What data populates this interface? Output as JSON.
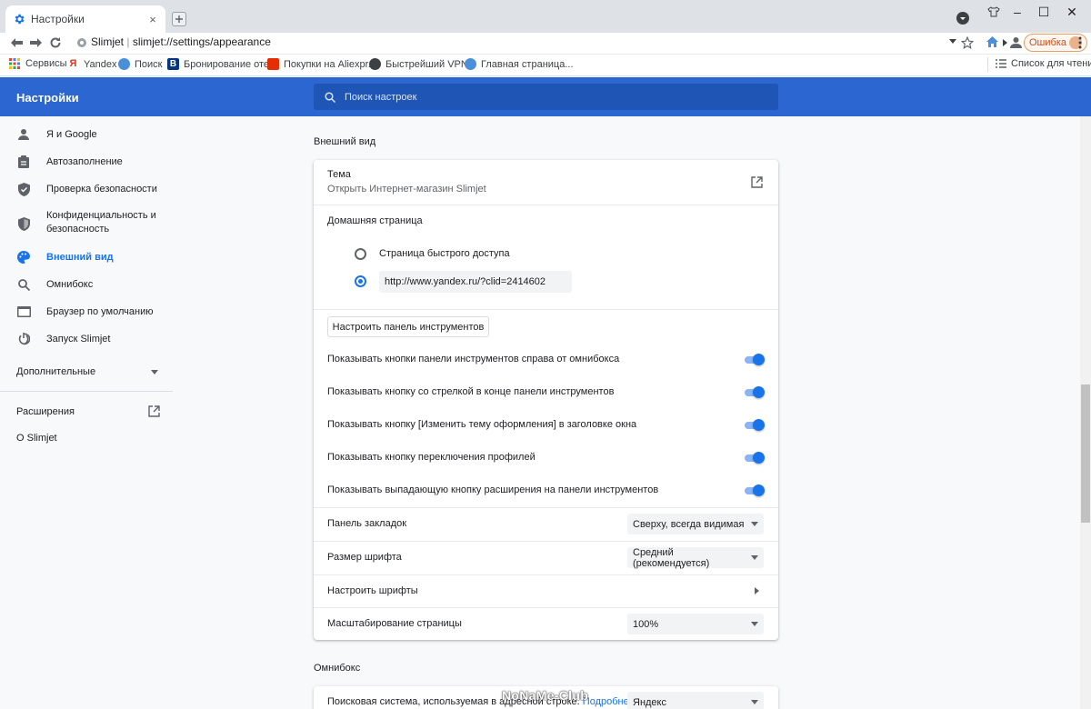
{
  "tab": {
    "title": "Настройки",
    "close": "×"
  },
  "window": {
    "minimize": "–",
    "maximize": "☐",
    "close": "✕"
  },
  "toolbar": {
    "site_name": "Slimjet",
    "url": "slimjet://settings/appearance",
    "error_label": "Ошибка"
  },
  "bookmarks": {
    "items": [
      "Сервисы",
      "Yandex",
      "Поиск",
      "Бронирование оте...",
      "Покупки на Aliexpr...",
      "Быстрейший VPN...",
      "Главная страница..."
    ],
    "reading_list": "Список для чтения"
  },
  "header": {
    "title": "Настройки",
    "search_placeholder": "Поиск настроек"
  },
  "sidebar": {
    "items": [
      {
        "label": "Я и Google",
        "icon": "person-icon"
      },
      {
        "label": "Автозаполнение",
        "icon": "clipboard-icon"
      },
      {
        "label": "Проверка безопасности",
        "icon": "shield-check-icon"
      },
      {
        "label": "Конфиденциальность и безопасность",
        "icon": "shield-lock-icon"
      },
      {
        "label": "Внешний вид",
        "icon": "palette-icon",
        "active": true
      },
      {
        "label": "Омнибокс",
        "icon": "search-icon"
      },
      {
        "label": "Браузер по умолчанию",
        "icon": "browser-icon"
      },
      {
        "label": "Запуск Slimjet",
        "icon": "power-icon"
      }
    ],
    "advanced": "Дополнительные",
    "extensions": "Расширения",
    "about": "О Slimjet"
  },
  "appearance": {
    "section_title": "Внешний вид",
    "theme_label": "Тема",
    "theme_sub": "Открыть Интернет-магазин Slimjet",
    "homepage_label": "Домашняя страница",
    "radio_newtab": "Страница быстрого доступа",
    "homepage_url": "http://www.yandex.ru/?clid=2414602",
    "customize_button": "Настроить панель инструментов",
    "toggles": [
      {
        "label": "Показывать кнопки панели инструментов справа от омнибокса",
        "on": true
      },
      {
        "label": "Показывать кнопку со стрелкой в конце панели инструментов",
        "on": true
      },
      {
        "label": "Показывать кнопку [Изменить тему оформления] в заголовке окна",
        "on": true
      },
      {
        "label": "Показывать кнопку переключения профилей",
        "on": true
      },
      {
        "label": "Показывать выпадающую кнопку расширения на панели инструментов",
        "on": true
      }
    ],
    "bookmarks_bar_label": "Панель закладок",
    "bookmarks_bar_value": "Сверху, всегда видимая",
    "font_size_label": "Размер шрифта",
    "font_size_value": "Средний (рекомендуется)",
    "customize_fonts": "Настроить шрифты",
    "zoom_label": "Масштабирование страницы",
    "zoom_value": "100%"
  },
  "omnibox": {
    "section_title": "Омнибокс",
    "search_engine_label": "Поисковая система, используемая в адресной строке.",
    "more_link": "Подробнее",
    "search_engine_value": "Яндекс"
  },
  "watermark": "NoNaMe-Club",
  "colors": {
    "accent": "#1a73e8",
    "header": "#2b66d1"
  }
}
